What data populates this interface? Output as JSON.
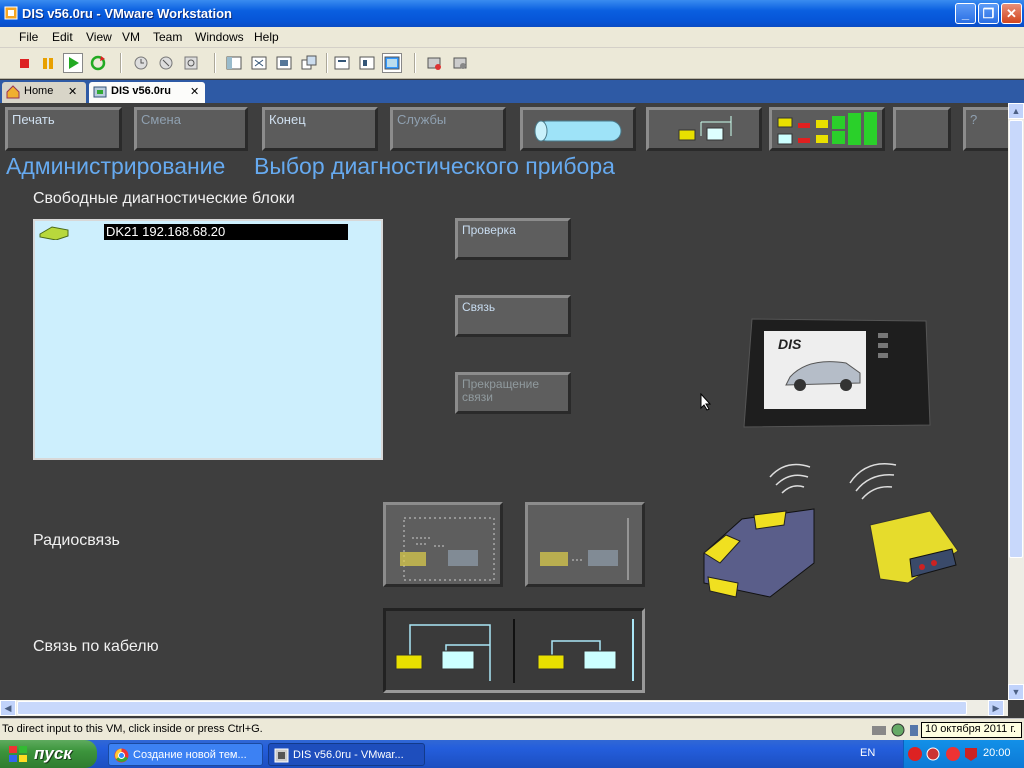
{
  "window": {
    "title": "DIS v56.0ru - VMware Workstation"
  },
  "menu": [
    "File",
    "Edit",
    "View",
    "VM",
    "Team",
    "Windows",
    "Help"
  ],
  "tabs": [
    {
      "label": "Home"
    },
    {
      "label": "DIS v56.0ru"
    }
  ],
  "dis": {
    "top_buttons": [
      "Печать",
      "Смена",
      "Конец",
      "Службы"
    ],
    "title_admin": "Администрирование",
    "title_select": "Выбор диагностического прибора",
    "free_blocks_label": "Свободные диагностические блоки",
    "device_entry": "DK21 192.168.68.20",
    "btn_check": "Проверка",
    "btn_connect": "Связь",
    "btn_disconnect": "Прекращение связи",
    "radio_label": "Радиосвязь",
    "cable_label": "Связь по кабелю",
    "screen_logo": "DIS",
    "help_label": "?"
  },
  "status": {
    "text": "To direct input to this VM, click inside or press Ctrl+G.",
    "date_tooltip": "10 октября 2011 г."
  },
  "taskbar": {
    "start": "пуск",
    "tasks": [
      "Создание новой тем...",
      "DIS v56.0ru - VMwar..."
    ],
    "lang": "EN",
    "clock": "20:00"
  },
  "colors": {
    "accent": "#66aaf0",
    "list_bg": "#cdeffd",
    "vm_bg": "#3e3e3e"
  }
}
